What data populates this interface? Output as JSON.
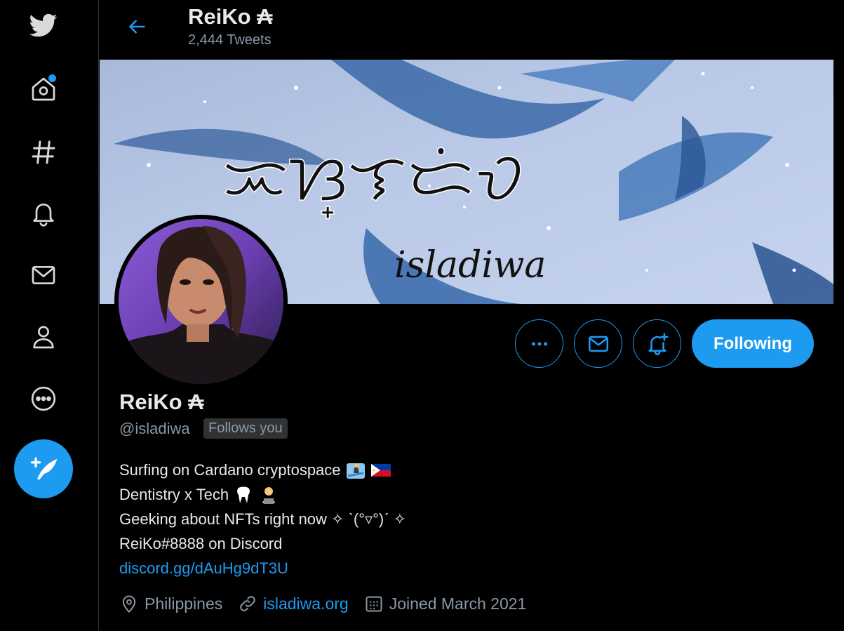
{
  "header": {
    "name": "ReiKo ₳",
    "tweet_count": "2,444 Tweets"
  },
  "banner": {
    "script_text": "ᜁᜐ᜔ᜎᜇᜒᜏ",
    "subtitle": "isladiwa"
  },
  "actions": {
    "follow_label": "Following"
  },
  "profile": {
    "name": "ReiKo ₳",
    "handle": "@isladiwa",
    "follows_badge": "Follows you",
    "bio": {
      "line1": "Surfing on Cardano cryptospace",
      "line2": "Dentistry x Tech",
      "line3": "Geeking about NFTs right now ✧ ˋ(°▿°)ˊ ✧",
      "line4": "ReiKo#8888 on Discord",
      "link": "discord.gg/dAuHg9dT3U"
    },
    "location": "Philippines",
    "website": "isladiwa.org",
    "joined": "Joined March 2021"
  },
  "icons": {
    "nav": [
      "twitter-logo-icon",
      "home-icon",
      "explore-hashtag-icon",
      "notifications-bell-icon",
      "messages-envelope-icon",
      "profile-person-icon",
      "more-circle-icon"
    ],
    "compose": "compose-feather-icon"
  },
  "colors": {
    "accent": "#1d9bf0",
    "background": "#000000",
    "muted": "#8b98a5"
  }
}
